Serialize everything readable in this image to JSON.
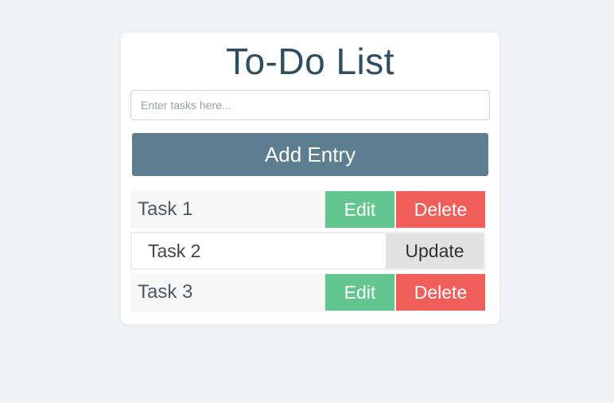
{
  "app": {
    "title": "To-Do List"
  },
  "input": {
    "placeholder": "Enter tasks here...",
    "value": ""
  },
  "add_button": {
    "label": "Add Entry"
  },
  "tasks": [
    {
      "label": "Task 1",
      "edit_label": "Edit",
      "delete_label": "Delete"
    },
    {
      "value": "Task 2",
      "update_label": "Update"
    },
    {
      "label": "Task 3",
      "edit_label": "Edit",
      "delete_label": "Delete"
    }
  ],
  "colors": {
    "background": "#f0f3f6",
    "title": "#2f4d60",
    "add_button": "#5d7e90",
    "edit_button": "#62c68e",
    "delete_button": "#ef5e58",
    "update_button": "#e1e1e1"
  }
}
